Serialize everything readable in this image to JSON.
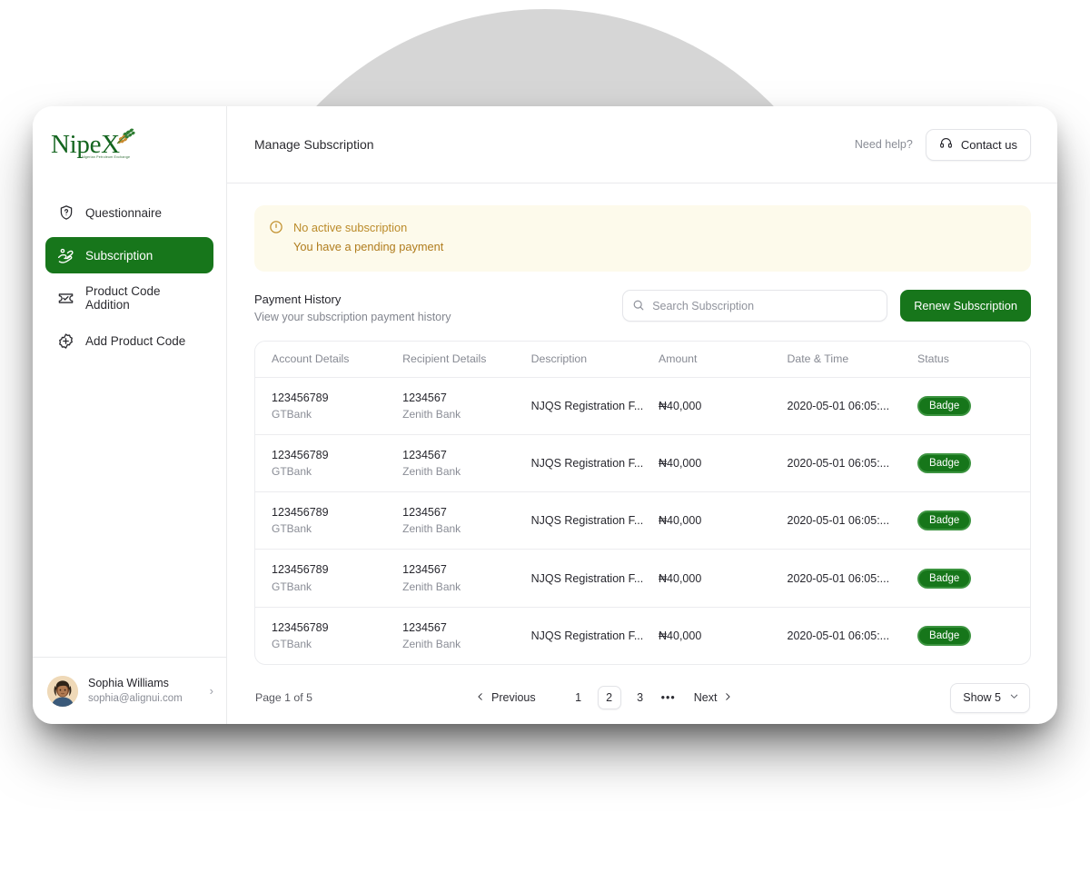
{
  "brand": {
    "name": "NipeX",
    "tagline": "Nigerian Petroleum Exchange"
  },
  "sidebar": {
    "items": [
      {
        "label": "Questionnaire",
        "icon": "shield-question-icon",
        "active": false
      },
      {
        "label": "Subscription",
        "icon": "subscription-hand-icon",
        "active": true
      },
      {
        "label": "Product Code Addition",
        "icon": "ticket-check-icon",
        "active": false
      },
      {
        "label": "Add Product Code",
        "icon": "plus-badge-icon",
        "active": false
      }
    ],
    "user": {
      "name": "Sophia Williams",
      "email": "sophia@alignui.com",
      "chevron": "›"
    }
  },
  "topbar": {
    "title": "Manage Subscription",
    "need_help": "Need help?",
    "contact_label": "Contact us",
    "contact_icon": "headset-icon"
  },
  "alert": {
    "icon": "alert-circle-icon",
    "line1": "No active subscription",
    "line2": "You have a pending payment",
    "bg": "#fdfaeb",
    "text_color": "#b07c1d"
  },
  "section": {
    "title": "Payment History",
    "subtitle": "View your subscription payment history",
    "search_placeholder": "Search Subscription",
    "search_value": "",
    "search_icon": "search-icon",
    "renew_label": "Renew Subscription",
    "accent": "#17761b"
  },
  "table": {
    "columns": [
      "Account Details",
      "Recipient Details",
      "Description",
      "Amount",
      "Date & Time",
      "Status"
    ],
    "rows": [
      {
        "account_no": "123456789",
        "account_bank": "GTBank",
        "recipient_no": "1234567",
        "recipient_bank": "Zenith Bank",
        "description": "NJQS Registration F...",
        "amount": "₦40,000",
        "datetime": "2020-05-01 06:05:...",
        "status": "Badge"
      },
      {
        "account_no": "123456789",
        "account_bank": "GTBank",
        "recipient_no": "1234567",
        "recipient_bank": "Zenith Bank",
        "description": "NJQS Registration F...",
        "amount": "₦40,000",
        "datetime": "2020-05-01 06:05:...",
        "status": "Badge"
      },
      {
        "account_no": "123456789",
        "account_bank": "GTBank",
        "recipient_no": "1234567",
        "recipient_bank": "Zenith Bank",
        "description": "NJQS Registration F...",
        "amount": "₦40,000",
        "datetime": "2020-05-01 06:05:...",
        "status": "Badge"
      },
      {
        "account_no": "123456789",
        "account_bank": "GTBank",
        "recipient_no": "1234567",
        "recipient_bank": "Zenith Bank",
        "description": "NJQS Registration F...",
        "amount": "₦40,000",
        "datetime": "2020-05-01 06:05:...",
        "status": "Badge"
      },
      {
        "account_no": "123456789",
        "account_bank": "GTBank",
        "recipient_no": "1234567",
        "recipient_bank": "Zenith Bank",
        "description": "NJQS Registration F...",
        "amount": "₦40,000",
        "datetime": "2020-05-01 06:05:...",
        "status": "Badge"
      }
    ]
  },
  "pagination": {
    "page_info": "Page 1 of 5",
    "previous_label": "Previous",
    "next_label": "Next",
    "pages": [
      "1",
      "2",
      "3"
    ],
    "active_page": "2",
    "ellipsis": "•••",
    "show_label": "Show 5"
  }
}
